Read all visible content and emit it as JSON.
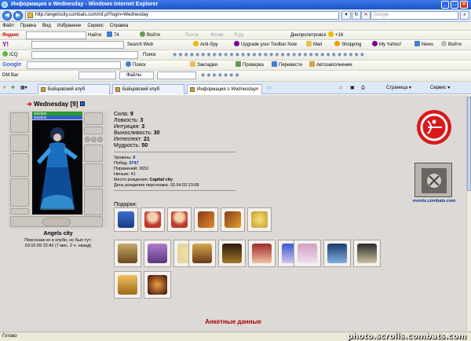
{
  "window": {
    "title": "Информация о Wednesday - Windows Internet Explorer"
  },
  "address": {
    "url": "http://angelscity.combats.com/inf.pl?login=Wednesday",
    "search_placeholder": "Google"
  },
  "menu": [
    "Файл",
    "Правка",
    "Вид",
    "Избранное",
    "Сервис",
    "Справка"
  ],
  "toolbar_yandex": {
    "brand": "Яндекс",
    "btn_find": "Найти",
    "count": "74",
    "btn_login": "Войти",
    "mail": "Почта",
    "photos": "Фотки",
    "yaru": "Я.ру",
    "city": "Днепропетровск",
    "temp": "+16"
  },
  "toolbar_yahoo": {
    "btn_search": "Search Web",
    "antispy": "Anti-Spy",
    "upgrade": "Upgrade your Toolbar Now",
    "mail": "Mail",
    "shopping": "Shopping",
    "my_yahoo": "My Yahoo!",
    "news": "News",
    "login": "Войти"
  },
  "toolbar_icq": {
    "icq": "ICQ",
    "search": "Поиск"
  },
  "toolbar_google": {
    "brand": "Google",
    "search": "Поиск",
    "bookmarks": "Закладки",
    "check": "Проверка",
    "translate": "Перевести",
    "autofill": "Автозаполнение"
  },
  "toolbar_dm": {
    "dm": "DM Bar",
    "files": "Файлы"
  },
  "tabs": [
    {
      "label": "Бойцовский клуб",
      "active": false
    },
    {
      "label": "Бойцовский клуб",
      "active": false
    },
    {
      "label": "Информация о Wednesday",
      "active": true
    }
  ],
  "tab_tools": {
    "page": "Страница",
    "service": "Сервис"
  },
  "character": {
    "login": "Wednesday",
    "level": "[9]",
    "hp": "260/260",
    "mana": "600/600",
    "city": "Angels city",
    "offline_note": "Персонаж не в клубе, но был тут:",
    "last_seen": "03.02.09 22:42 (7 мес. 2 ч. назад)"
  },
  "stats": [
    {
      "label": "Сила:",
      "value": "9"
    },
    {
      "label": "Ловкость:",
      "value": "3"
    },
    {
      "label": "Интуиция:",
      "value": "3"
    },
    {
      "label": "Выносливость:",
      "value": "30"
    },
    {
      "label": "Интеллект:",
      "value": "21"
    },
    {
      "label": "Мудрость:",
      "value": "50"
    }
  ],
  "info": [
    {
      "label": "Уровень:",
      "value": "9",
      "blue": true
    },
    {
      "label": "Побед:",
      "value": "2747",
      "blue": true
    },
    {
      "label": "Поражений:",
      "value": "2651",
      "blue": false
    },
    {
      "label": "Ничьих:",
      "value": "41",
      "blue": false
    },
    {
      "label": "Место рождения:",
      "value": "Capital city",
      "blue": false,
      "bold": true
    },
    {
      "label": "День рождения персонажа:",
      "value": "02.04.03 23:08",
      "blue": false
    }
  ],
  "gifts_label": "Подарки:",
  "events_link": "events.combats.com",
  "section_title": "Анкетные данные",
  "status": {
    "text": "Готово",
    "watermark": "photo.scrolls.combats.com"
  },
  "colors": {
    "accent": "#cc0000",
    "link": "#003399",
    "hp": "#2c9a2c",
    "mana": "#2f62c8"
  }
}
